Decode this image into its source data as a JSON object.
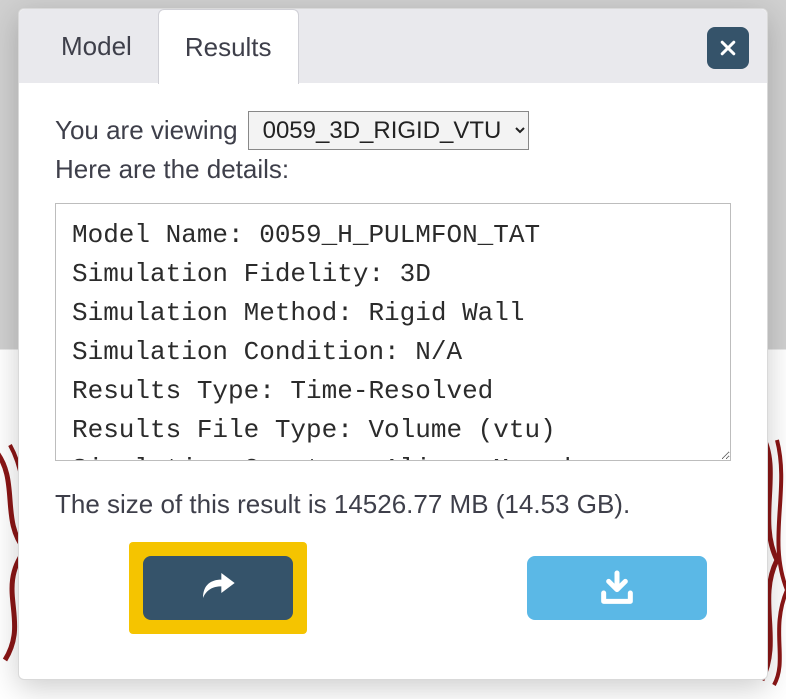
{
  "tabs": {
    "model": "Model",
    "results": "Results"
  },
  "viewing": {
    "prefix": "You are viewing",
    "selected": "0059_3D_RIGID_VTU"
  },
  "details_label": "Here are the details:",
  "details": {
    "lines": [
      "Model Name: 0059_H_PULMFON_TAT",
      "Simulation Fidelity: 3D",
      "Simulation Method: Rigid Wall",
      "Simulation Condition: N/A",
      "Results Type: Time-Resolved",
      "Results File Type: Volume (vtu)",
      "Simulation Creator: Alison Marsden"
    ]
  },
  "size_line": "The size of this result is 14526.77 MB (14.53 GB).",
  "buttons": {
    "share": "share",
    "download": "download"
  }
}
